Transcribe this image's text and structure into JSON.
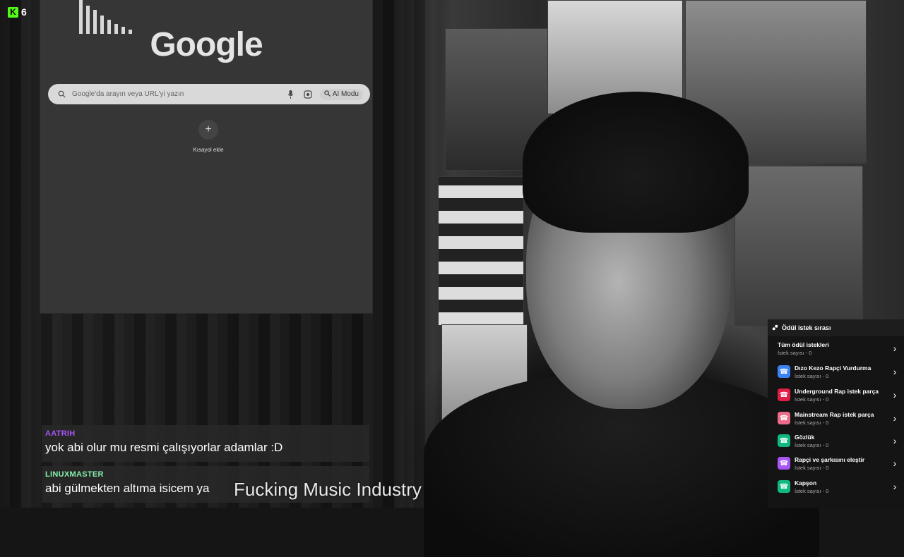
{
  "stream": {
    "viewer_count": "6",
    "kick_logo_letter": "K",
    "now_playing": "Fucking Music Industry"
  },
  "browser": {
    "logo_text": "Google",
    "search": {
      "placeholder": "Google'da arayın veya URL'yi yazın",
      "ai_mode_label": "AI Modu"
    },
    "shortcut": {
      "label": "Kısayol ekle"
    }
  },
  "chat": {
    "messages": [
      {
        "user": "AATRIH",
        "user_color": "#a855f7",
        "text": "yok abi olur mu resmi çalışıyorlar adamlar :D"
      },
      {
        "user": "LINUXMASTER",
        "user_color": "#86efac",
        "text": "abi gülmekten altıma isicem ya"
      }
    ]
  },
  "rewards": {
    "title": "Ödül istek sırası",
    "items": [
      {
        "title": "Tüm ödül istekleri",
        "count": "İstek sayısı - 0",
        "icon": "none",
        "color": ""
      },
      {
        "title": "Dızo Kezo Rapçi Vurdurma",
        "count": "İstek sayısı - 0",
        "icon": "reward-icon",
        "color": "#3b82f6"
      },
      {
        "title": "Underground Rap istek parça",
        "count": "İstek sayısı - 0",
        "icon": "reward-icon",
        "color": "#e11d48"
      },
      {
        "title": "Mainstream Rap istek parça",
        "count": "İstek sayısı - 0",
        "icon": "reward-icon",
        "color": "#ec6a8a"
      },
      {
        "title": "Gözlük",
        "count": "İstek sayısı - 0",
        "icon": "reward-icon",
        "color": "#10b981"
      },
      {
        "title": "Rapçi ve şarkısını eleştir",
        "count": "İstek sayısı - 0",
        "icon": "reward-icon",
        "color": "#a855f7"
      },
      {
        "title": "Kapşon",
        "count": "İstek sayısı - 0",
        "icon": "reward-icon",
        "color": "#10b981"
      }
    ]
  }
}
